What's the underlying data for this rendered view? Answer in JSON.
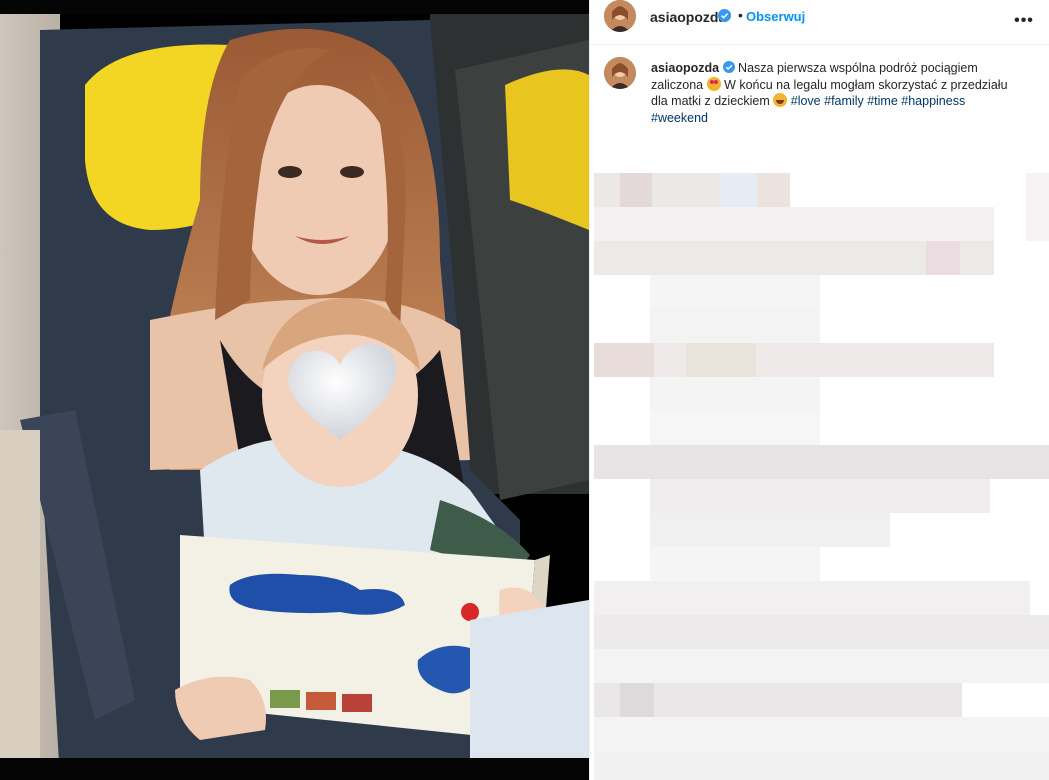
{
  "post": {
    "username": "asiaopozda",
    "separator": "•",
    "follow_label": "Obserwuj",
    "more_label": "•••"
  },
  "caption": {
    "username": "asiaopozda",
    "text_part1": "Nasza pierwsza wspólna podróż pociągiem zaliczona ",
    "text_part2": " W końcu na legalu mogłam skorzystać z przedziału dla matki z dzieckiem ",
    "hashtags": [
      "#love",
      "#family",
      "#time",
      "#happiness",
      "#weekend"
    ]
  },
  "colors": {
    "accent": "#0095f6",
    "hashtag": "#00376b",
    "verified": "#3897f0"
  },
  "icons": {
    "verified": "verified-badge-icon",
    "more": "more-options-icon",
    "emoji1": "heart-eyes-emoji-icon",
    "emoji2": "laughing-emoji-icon"
  },
  "comments_section": "pixelated-blurred"
}
